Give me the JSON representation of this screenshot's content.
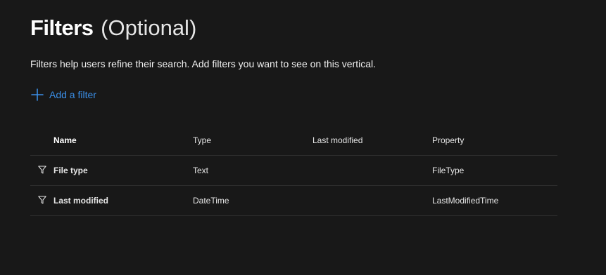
{
  "header": {
    "title": "Filters",
    "title_suffix": "(Optional)",
    "description": "Filters help users refine their search. Add filters you want to see on this vertical."
  },
  "actions": {
    "add_filter_label": "Add a filter",
    "add_filter_icon": "plus-icon"
  },
  "colors": {
    "background": "#181818",
    "accent": "#3a8ee6",
    "divider": "#2e2e2e"
  },
  "table": {
    "columns": [
      "Name",
      "Type",
      "Last modified",
      "Property"
    ],
    "rows": [
      {
        "icon": "filter-icon",
        "name": "File type",
        "type": "Text",
        "last_modified": "",
        "property": "FileType"
      },
      {
        "icon": "filter-icon",
        "name": "Last modified",
        "type": "DateTime",
        "last_modified": "",
        "property": "LastModifiedTime"
      }
    ]
  }
}
